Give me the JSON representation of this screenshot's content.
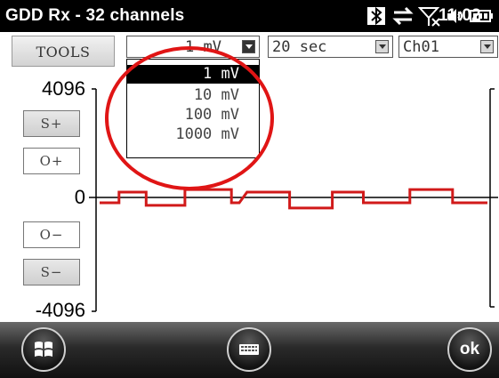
{
  "titlebar": {
    "app_title": "GDD Rx - 32 channels",
    "clock": "11:02",
    "icons": [
      "bluetooth-icon",
      "data-sync-icon",
      "no-signal-icon",
      "volume-icon",
      "battery-icon"
    ]
  },
  "toolbar": {
    "tools_label": "TOOLS",
    "scale_value": "1 mV",
    "time_value": "20 sec",
    "channel_value": "Ch01"
  },
  "scale_dropdown": {
    "options": [
      "1 mV",
      "10 mV",
      "100 mV",
      "1000 mV"
    ],
    "selected_index": 0
  },
  "side_buttons": {
    "s_plus": "S+",
    "o_plus": "O+",
    "o_minus": "O−",
    "s_minus": "S−"
  },
  "axis": {
    "y_max": "4096",
    "y_zero": "0",
    "y_min": "-4096"
  },
  "signal": {
    "color": "#d11a1a",
    "x_range": [
      0,
      100
    ],
    "y_range": [
      -4096,
      4096
    ],
    "points": [
      [
        0,
        -10
      ],
      [
        5,
        -10
      ],
      [
        5,
        10
      ],
      [
        12,
        10
      ],
      [
        12,
        -15
      ],
      [
        22,
        -15
      ],
      [
        22,
        15
      ],
      [
        34,
        15
      ],
      [
        34,
        -10
      ],
      [
        36,
        -10
      ],
      [
        38,
        10
      ],
      [
        49,
        10
      ],
      [
        49,
        -20
      ],
      [
        60,
        -20
      ],
      [
        60,
        10
      ],
      [
        68,
        10
      ],
      [
        68,
        -10
      ],
      [
        80,
        -10
      ],
      [
        80,
        15
      ],
      [
        91,
        15
      ],
      [
        91,
        -10
      ],
      [
        100,
        -10
      ]
    ]
  },
  "bottombar": {
    "ok_label": "ok"
  },
  "colors": {
    "highlight": "#e01515",
    "titlebar_bg": "#000000"
  }
}
